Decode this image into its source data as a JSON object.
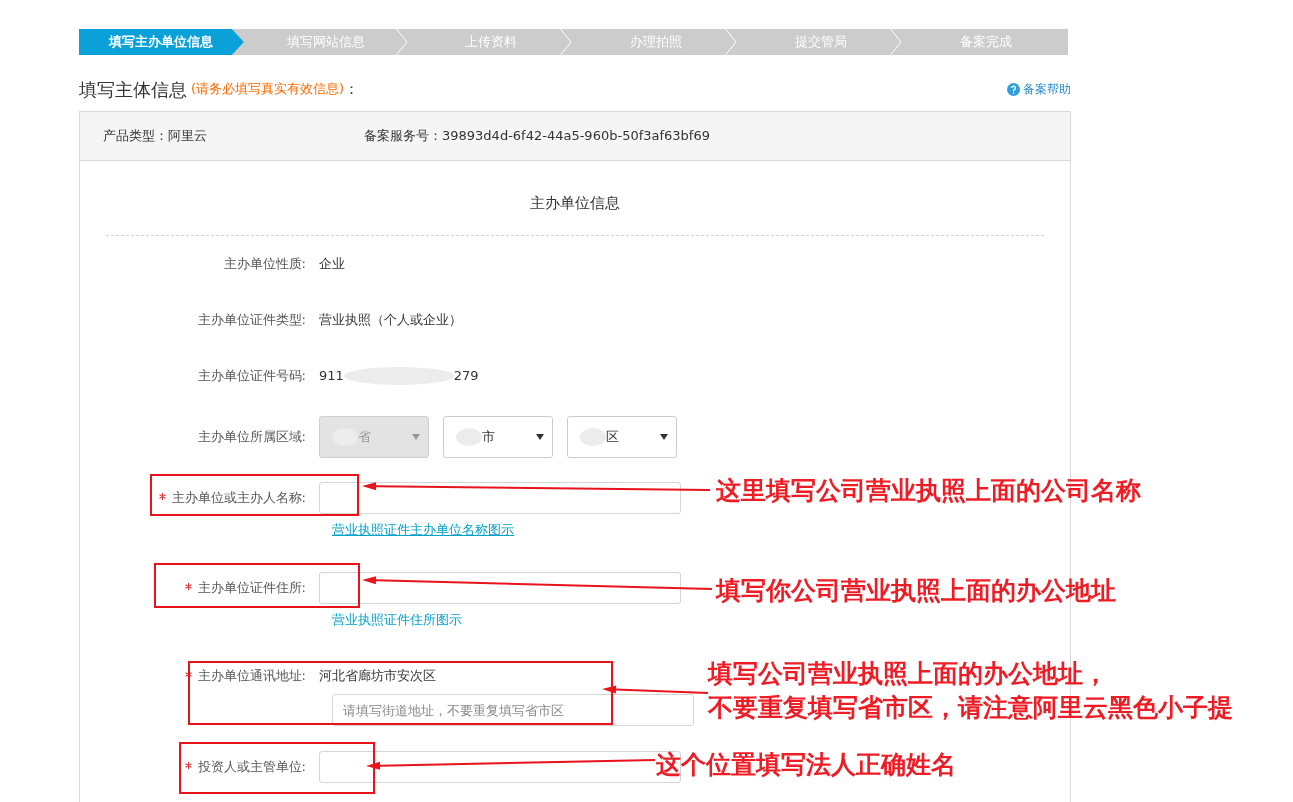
{
  "steps": [
    {
      "label": "填写主办单位信息",
      "selected": true
    },
    {
      "label": "填写网站信息",
      "selected": false
    },
    {
      "label": "上传资料",
      "selected": false
    },
    {
      "label": "办理拍照",
      "selected": false
    },
    {
      "label": "提交管局",
      "selected": false
    },
    {
      "label": "备案完成",
      "selected": false
    }
  ],
  "heading": {
    "title": "填写主体信息",
    "note": "(请务必填写真实有效信息)",
    "colon": "："
  },
  "help_link": "备案帮助",
  "info": {
    "product_type": "产品类型：阿里云",
    "service_number": "备案服务号：39893d4d-6f42-44a5-960b-50f3af63bf69"
  },
  "section_title": "主办单位信息",
  "fields": [
    {
      "kind": "text",
      "label": "主办单位性质:",
      "required": false,
      "value": "企业"
    },
    {
      "kind": "text",
      "label": "主办单位证件类型:",
      "required": false,
      "value": "营业执照（个人或企业）"
    },
    {
      "kind": "masked",
      "label": "主办单位证件号码:",
      "required": false,
      "parts": [
        "911",
        "279"
      ]
    },
    {
      "kind": "selects",
      "label": "主办单位所属区域:",
      "required": false,
      "selects": [
        {
          "value": "省",
          "disabled": true
        },
        {
          "value": "市",
          "disabled": false
        },
        {
          "value": "区",
          "disabled": false
        }
      ]
    },
    {
      "kind": "input",
      "label": "主办单位或主办人名称:",
      "required": true,
      "link": {
        "text": "营业执照证件主办单位名称图示",
        "underlined": true
      }
    },
    {
      "kind": "input",
      "label": "主办单位证件住所:",
      "required": true,
      "link": {
        "text": "营业执照证件住所图示",
        "underlined": false
      }
    },
    {
      "kind": "address",
      "label": "主办单位通讯地址:",
      "required": true,
      "value": "河北省廊坊市安次区",
      "placeholder": "请填写街道地址，不要重复填写省市区"
    },
    {
      "kind": "input",
      "label": "投资人或主管单位:",
      "required": true
    }
  ],
  "annotations": [
    {
      "lines": [
        "这里填写公司营业执照上面的公司名称"
      ]
    },
    {
      "lines": [
        "填写你公司营业执照上面的办公地址"
      ]
    },
    {
      "lines": [
        "填写公司营业执照上面的办公地址，",
        "不要重复填写省市区，请注意阿里云黑色小子提"
      ]
    },
    {
      "lines": [
        "这个位置填写法人正确姓名"
      ]
    }
  ]
}
